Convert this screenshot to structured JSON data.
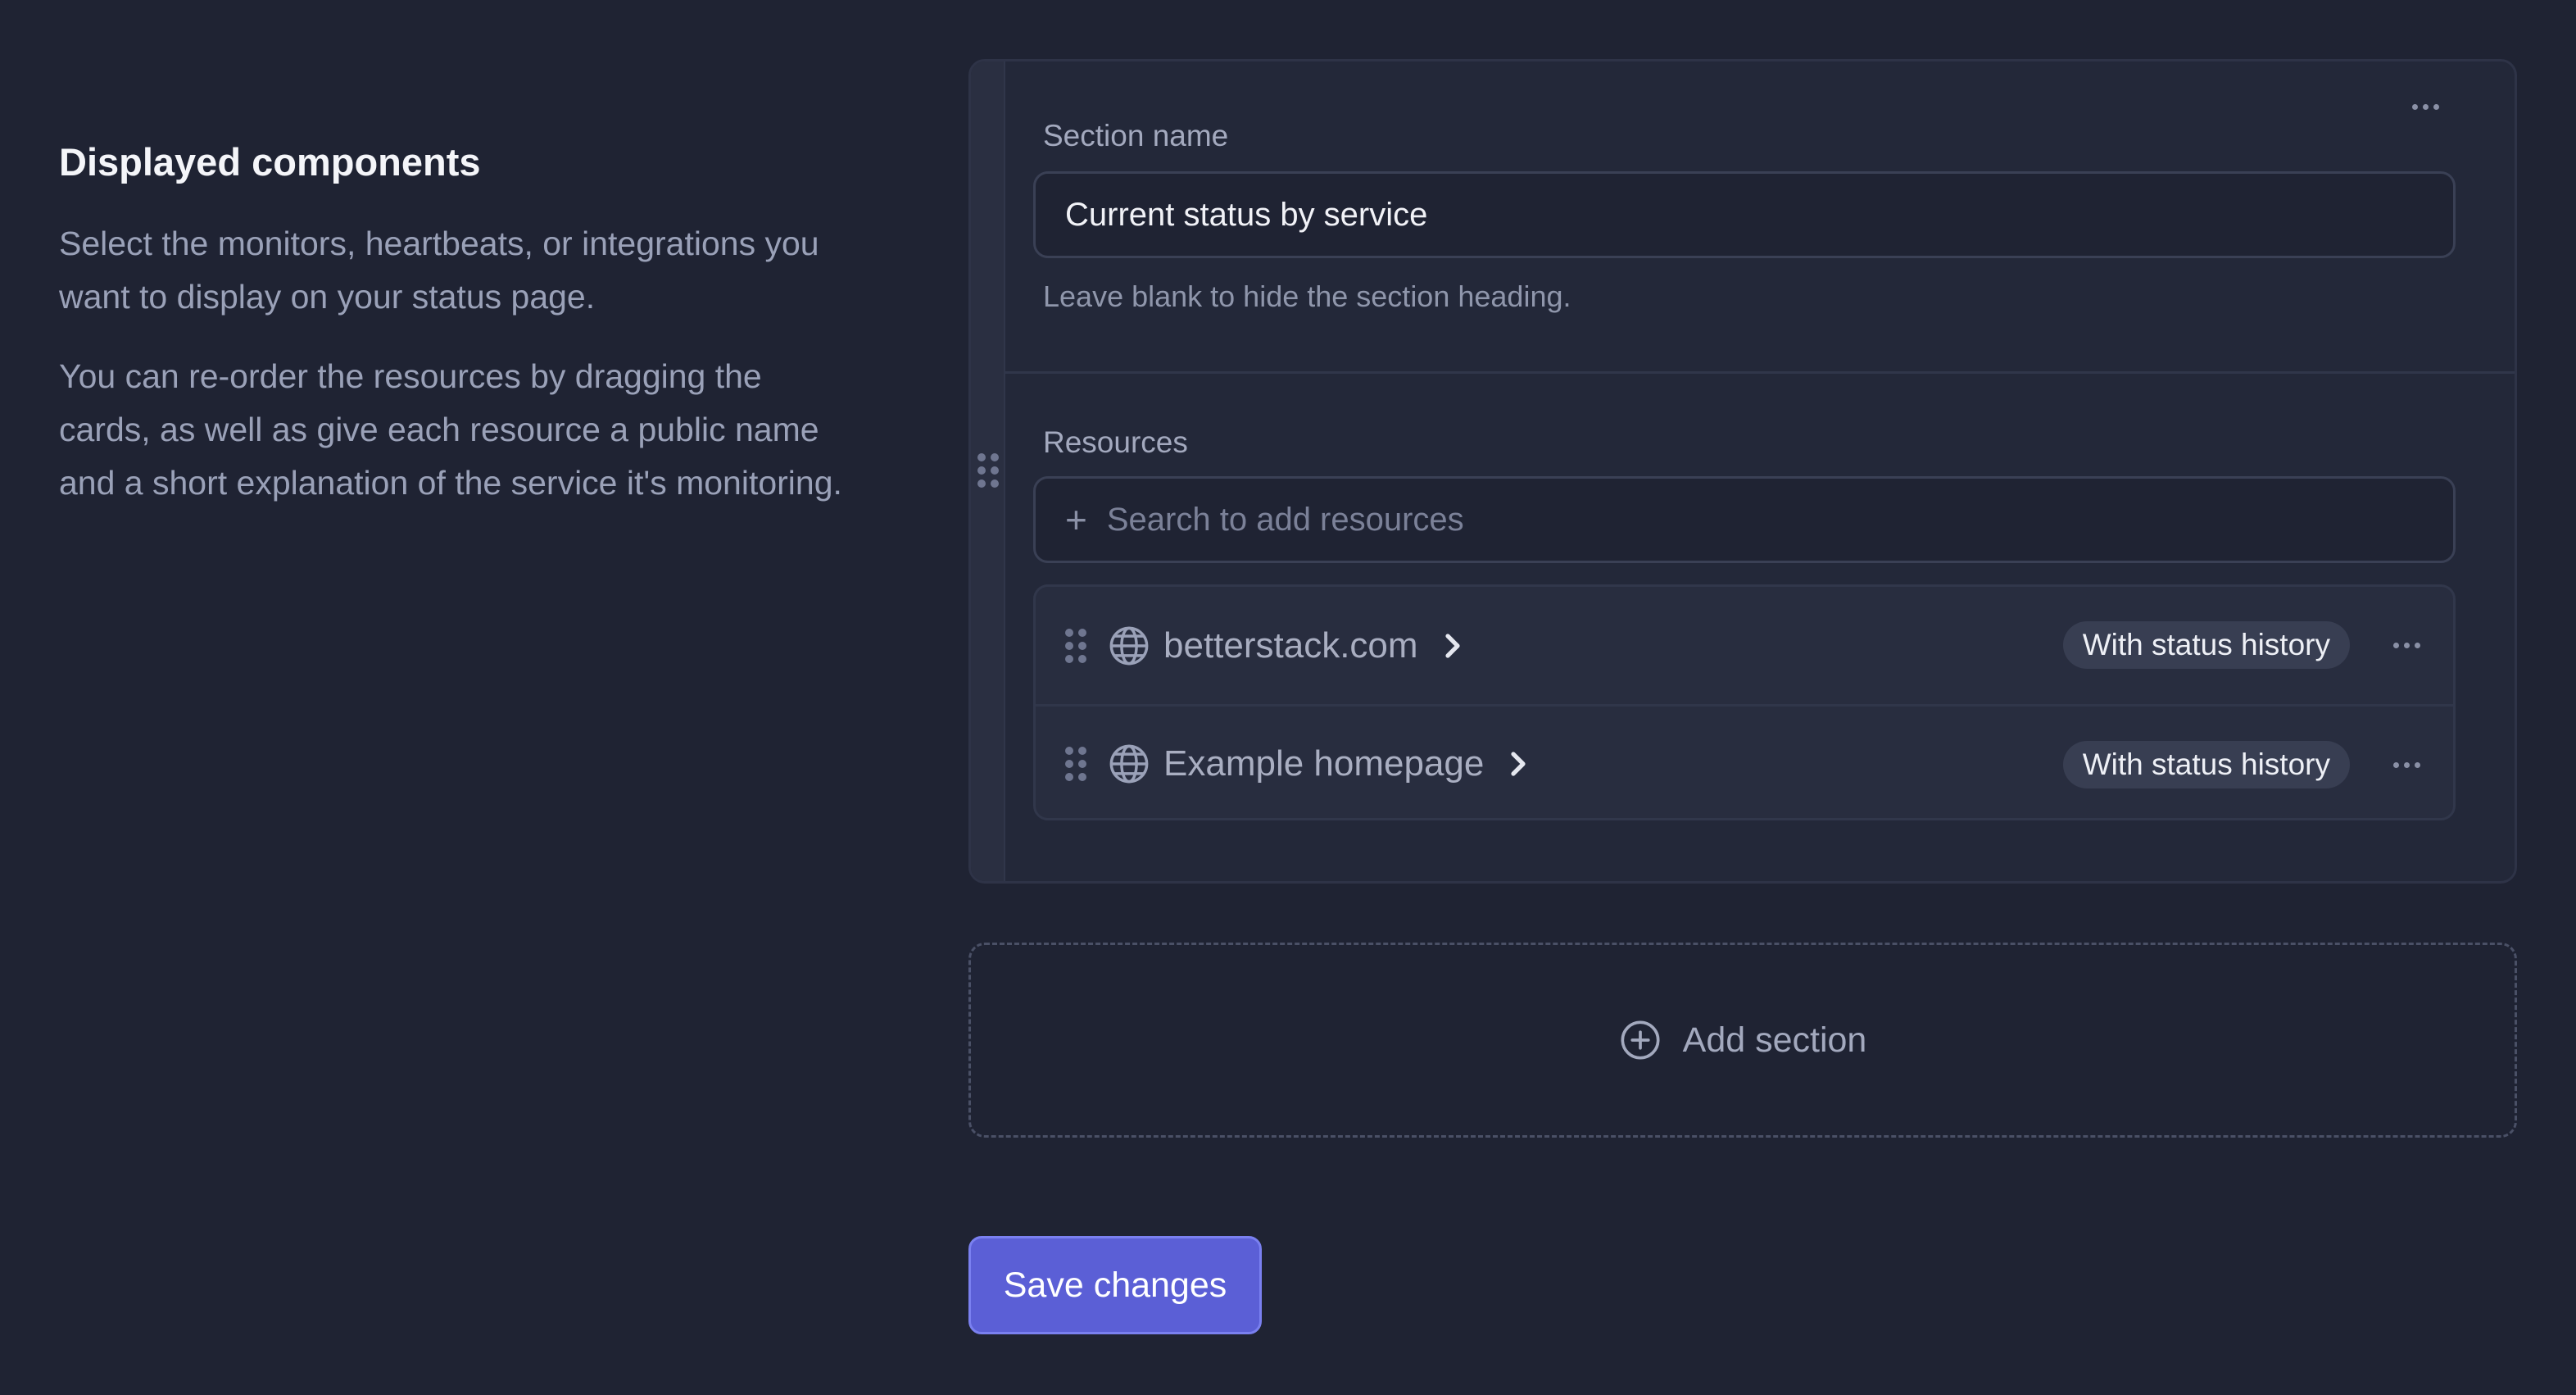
{
  "intro": {
    "title": "Displayed components",
    "paragraph1": "Select the monitors, heartbeats, or integrations you want to display on your status page.",
    "paragraph2": "You can re-order the resources by dragging the cards, as well as give each resource a public name and a short explanation of the service it's monitoring."
  },
  "section": {
    "name_label": "Section name",
    "name_value": "Current status by service",
    "hint": "Leave blank to hide the section heading.",
    "resources_label": "Resources",
    "search_placeholder": "Search to add resources",
    "search_icon": "plus-icon",
    "resources": [
      {
        "name": "betterstack.com",
        "icon": "globe-icon",
        "badge": "With status history"
      },
      {
        "name": "Example homepage",
        "icon": "globe-icon",
        "badge": "With status history"
      }
    ]
  },
  "add_section": {
    "label": "Add section",
    "icon": "plus-circle-icon"
  },
  "save": {
    "label": "Save changes"
  },
  "colors": {
    "background": "#1f2333",
    "card": "#232839",
    "accent": "#5b5fd6"
  }
}
